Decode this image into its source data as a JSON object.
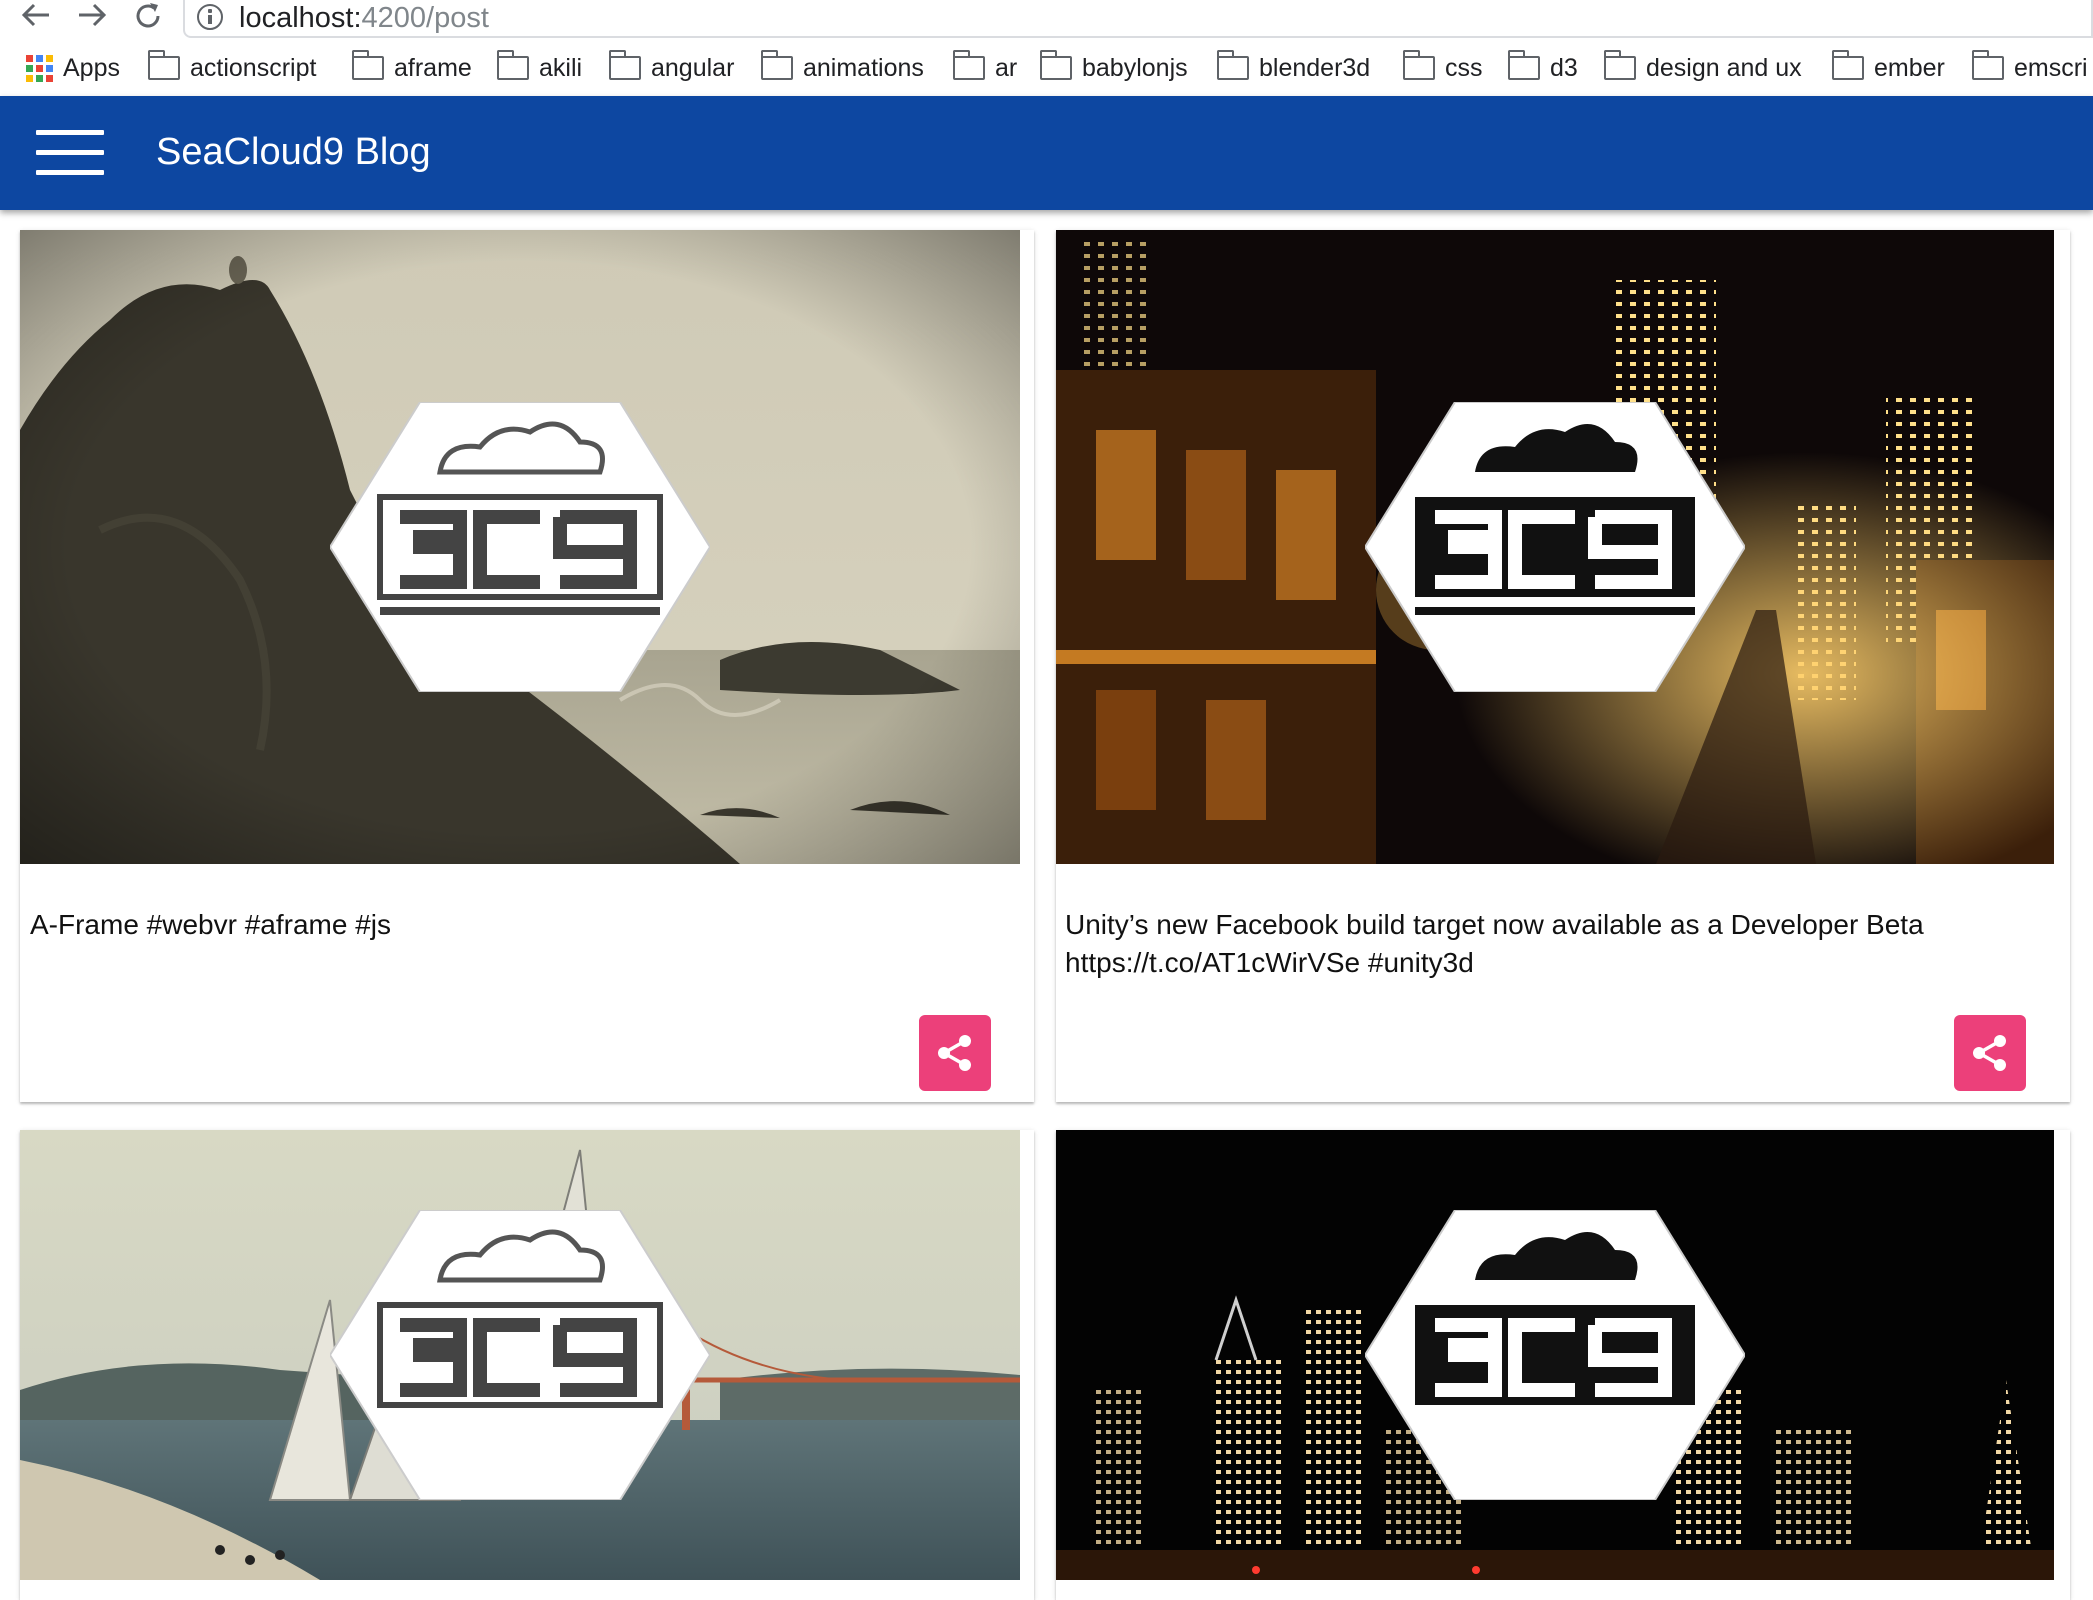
{
  "browser": {
    "url_host": "localhost:",
    "url_path": "4200/post",
    "bookmarks": {
      "apps": "Apps",
      "items": [
        "actionscript",
        "aframe",
        "akili",
        "angular",
        "animations",
        "ar",
        "babylonjs",
        "blender3d",
        "css",
        "d3",
        "design and ux",
        "ember",
        "emscri"
      ]
    }
  },
  "app": {
    "title": "SeaCloud9 Blog",
    "primary_color": "#0d47a1",
    "accent_color": "#ec407a"
  },
  "posts": [
    {
      "text": "A-Frame #webvr #aframe #js",
      "image": "rocky-coast-seagull"
    },
    {
      "text_line1": "Unity’s new Facebook build target now available as a Developer Beta",
      "text_line2": "https://t.co/AT1cWirVSe #unity3d",
      "image": "city-street-night"
    },
    {
      "text": "",
      "image": "sailboats-golden-gate"
    },
    {
      "text": "",
      "image": "city-skyline-night"
    }
  ]
}
